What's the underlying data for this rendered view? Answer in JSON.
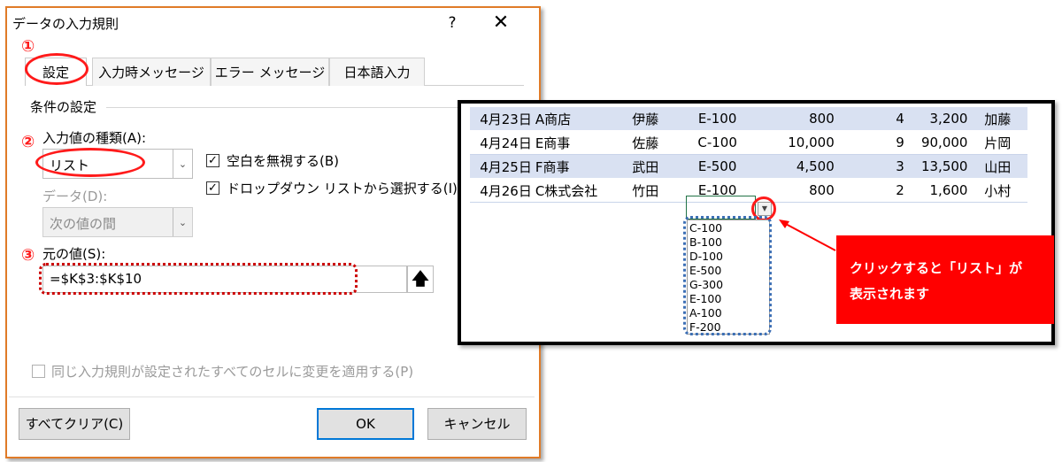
{
  "dialog": {
    "title": "データの入力規則",
    "help": "?",
    "close": "✕",
    "tabs": [
      {
        "label": "設定"
      },
      {
        "label": "入力時メッセージ"
      },
      {
        "label": "エラー メッセージ"
      },
      {
        "label": "日本語入力"
      }
    ],
    "section": "条件の設定",
    "allow_label": "入力値の種類(A):",
    "allow_value": "リスト",
    "data_label": "データ(D):",
    "data_value": "次の値の間",
    "ignore_blank": {
      "label": "空白を無視する(B)",
      "checked": true
    },
    "in_cell_dropdown": {
      "label": "ドロップダウン リストから選択する(I)",
      "checked": true
    },
    "source_label": "元の値(S):",
    "source_value": "=$K$3:$K$10",
    "apply_all": {
      "label": "同じ入力規則が設定されたすべてのセルに変更を適用する(P)",
      "checked": false
    },
    "buttons": {
      "clear_all": "すべてクリア(C)",
      "ok": "OK",
      "cancel": "キャンセル"
    }
  },
  "annotations": {
    "mark1": "①",
    "mark2": "②",
    "mark3": "③"
  },
  "sheet": {
    "rows": [
      {
        "date": "4月23日",
        "customer": "A商店",
        "rep": "伊藤",
        "code": "E-100",
        "price": "800",
        "qty": "4",
        "amount": "3,200",
        "staff": "加藤"
      },
      {
        "date": "4月24日",
        "customer": "E商事",
        "rep": "佐藤",
        "code": "C-100",
        "price": "10,000",
        "qty": "9",
        "amount": "90,000",
        "staff": "片岡"
      },
      {
        "date": "4月25日",
        "customer": "F商事",
        "rep": "武田",
        "code": "E-500",
        "price": "4,500",
        "qty": "3",
        "amount": "13,500",
        "staff": "山田"
      },
      {
        "date": "4月26日",
        "customer": "C株式会社",
        "rep": "竹田",
        "code": "E-100",
        "price": "800",
        "qty": "2",
        "amount": "1,600",
        "staff": "小村"
      }
    ],
    "dropdown_items": [
      "C-100",
      "B-100",
      "D-100",
      "E-500",
      "G-300",
      "E-100",
      "A-100",
      "F-200"
    ]
  },
  "callout": {
    "line1": "クリックすると「リスト」が",
    "line2": "表示されます"
  },
  "colors": {
    "accent_red": "#ff0000",
    "band_blue": "#d9e1f2",
    "dialog_border": "#e07b28",
    "ok_border": "#0078d7"
  }
}
